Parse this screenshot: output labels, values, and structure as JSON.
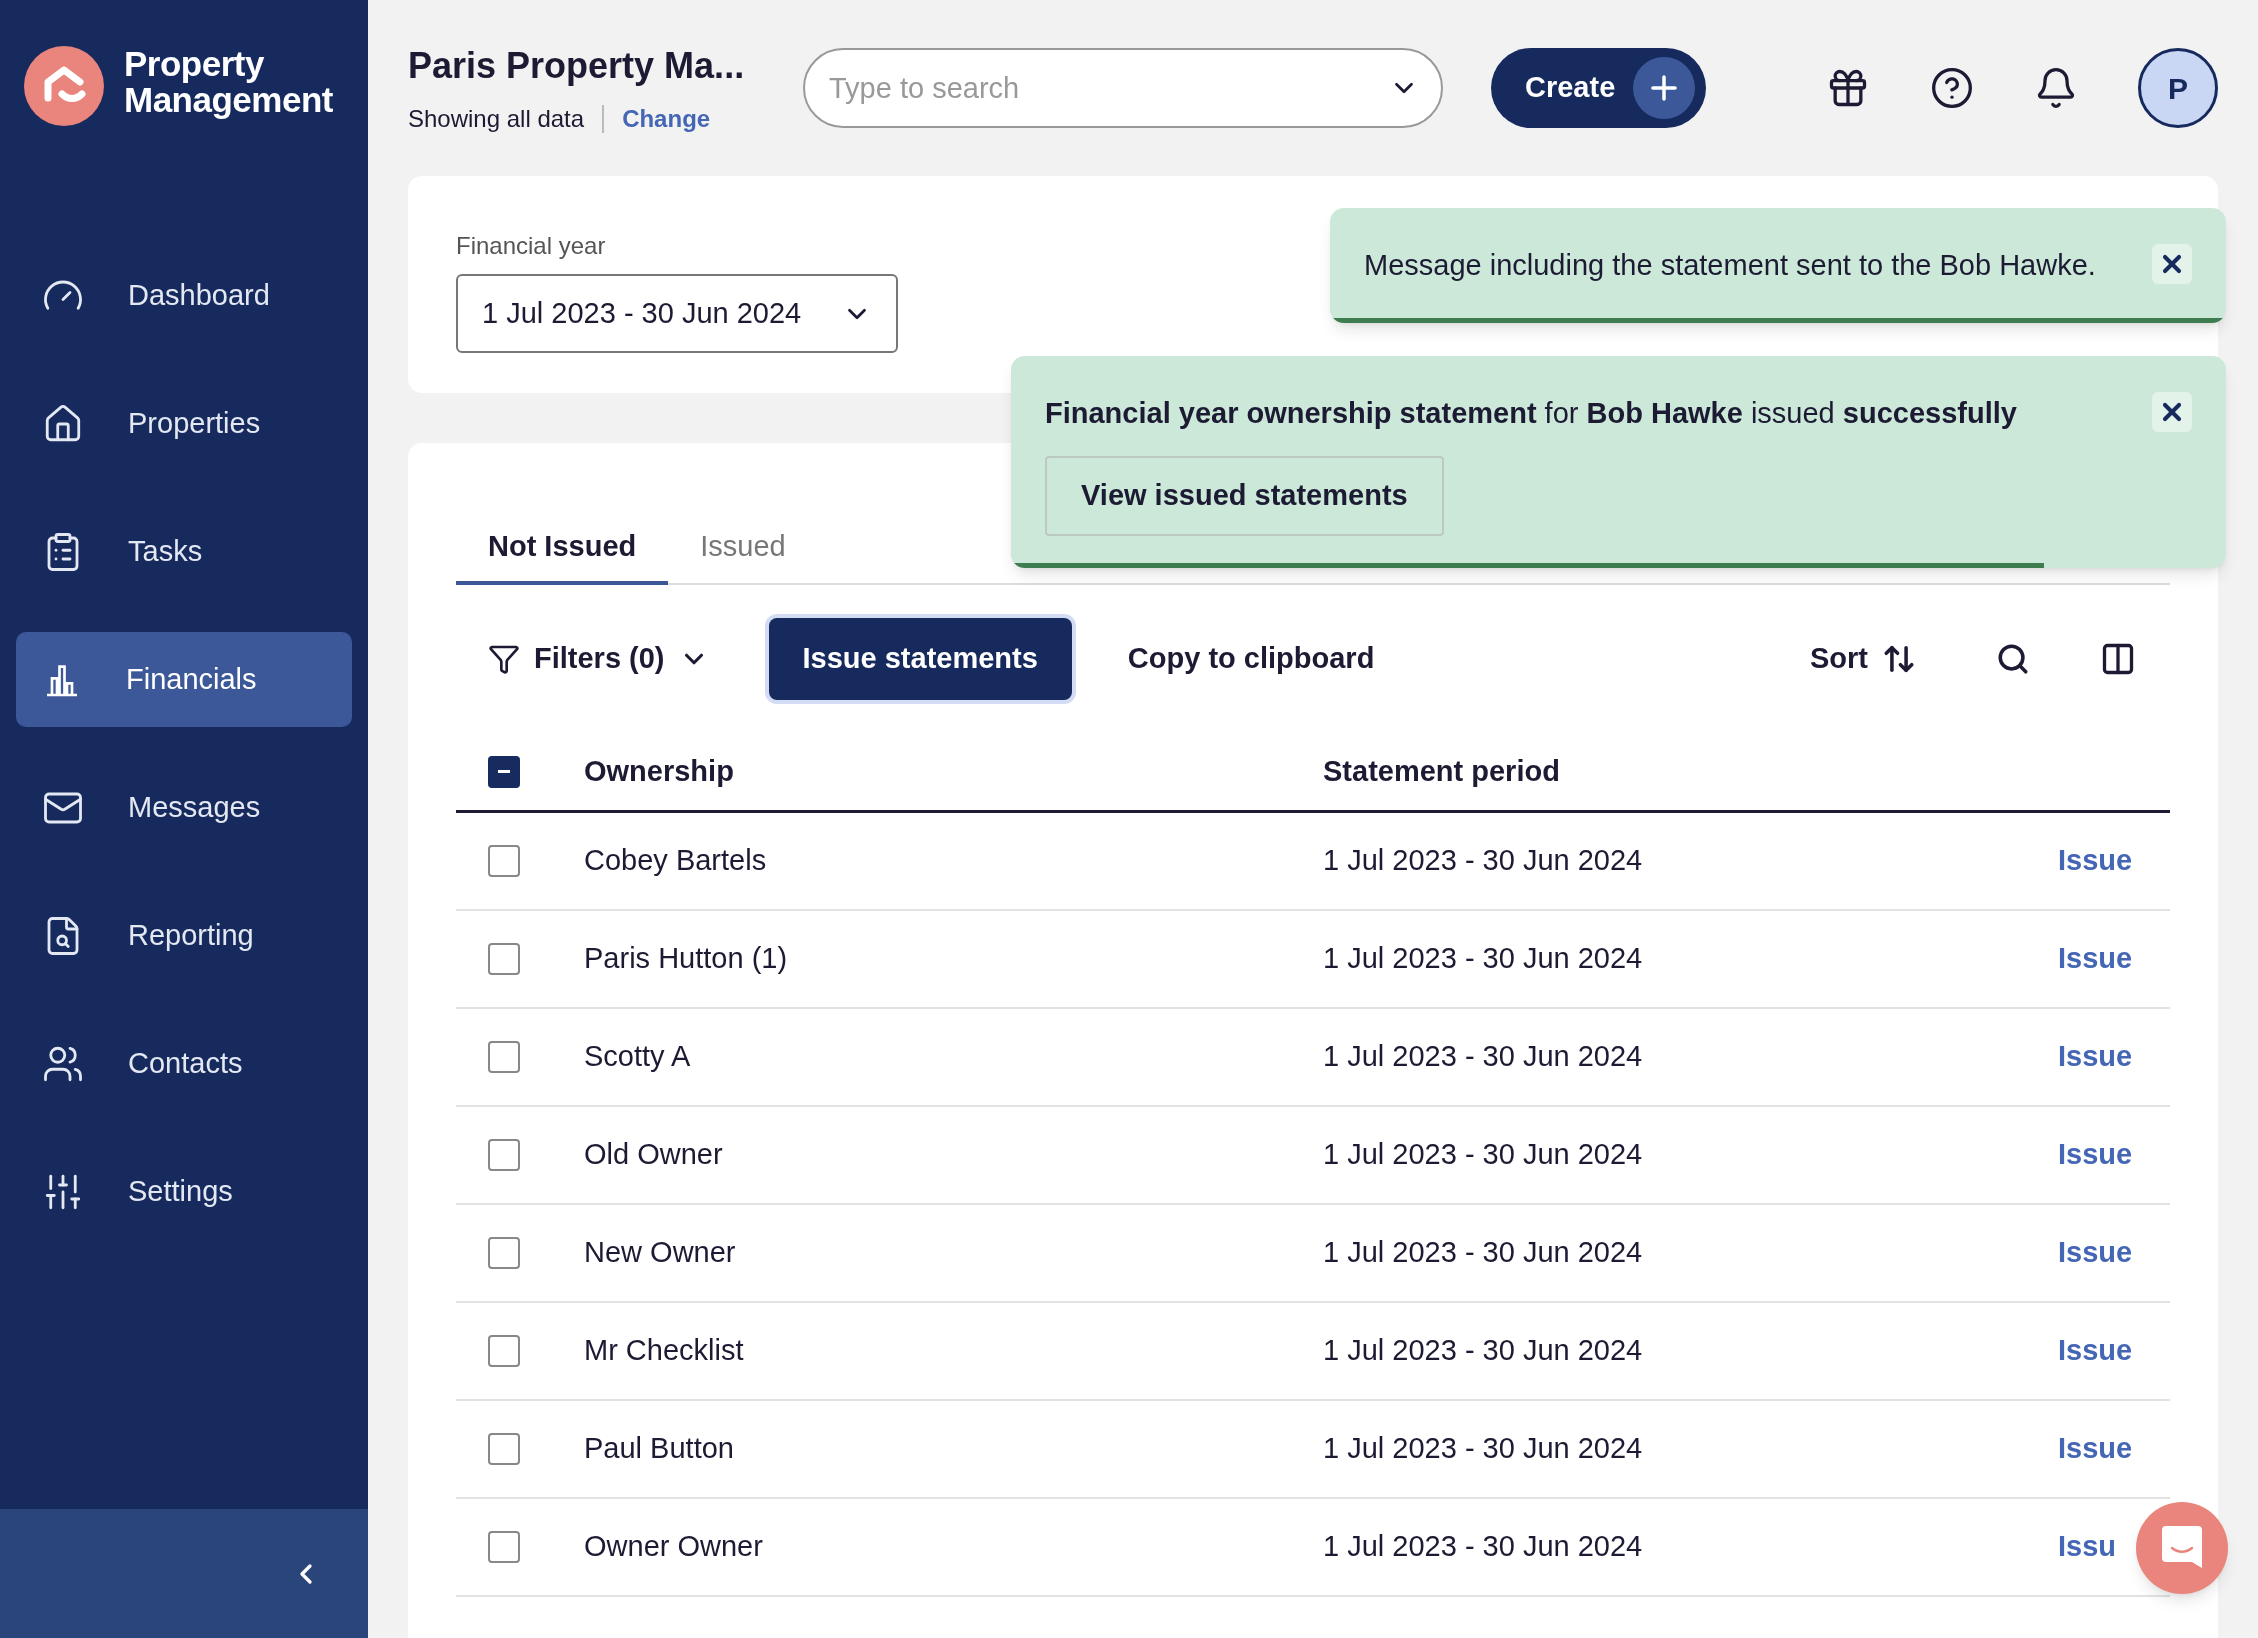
{
  "brand": {
    "name": "Property Management"
  },
  "sidebar": {
    "items": [
      {
        "label": "Dashboard",
        "selected": false
      },
      {
        "label": "Properties",
        "selected": false
      },
      {
        "label": "Tasks",
        "selected": false
      },
      {
        "label": "Financials",
        "selected": true
      },
      {
        "label": "Messages",
        "selected": false
      },
      {
        "label": "Reporting",
        "selected": false
      },
      {
        "label": "Contacts",
        "selected": false
      },
      {
        "label": "Settings",
        "selected": false
      }
    ]
  },
  "header": {
    "title": "Paris Property Ma...",
    "subtitle": "Showing all data",
    "change_link": "Change",
    "search": {
      "placeholder": "Type to search"
    },
    "create_button": "Create",
    "avatar": "P"
  },
  "financial_year": {
    "label": "Financial year",
    "value": "1 Jul 2023 - 30 Jun 2024"
  },
  "toasts": [
    {
      "text": "Message including the statement sent to the Bob Hawke.",
      "level": 1
    },
    {
      "text": "**Financial year ownership statement** for **Bob Hawke** issued **successfully**",
      "button": "View issued statements",
      "level": 0.85
    }
  ],
  "tabs": [
    {
      "label": "Not Issued",
      "selected": true
    },
    {
      "label": "Issued",
      "selected": false
    }
  ],
  "toolbar": {
    "filters": "Filters (0)",
    "issue_button": "Issue statements",
    "copy_button": "Copy to clipboard",
    "sort": "Sort"
  },
  "table": {
    "header_checkbox": {
      "indeterminate": true
    },
    "columns": [
      "Ownership",
      "Statement period"
    ],
    "rows": [
      {
        "ownership": "Cobey Bartels",
        "period": "1 Jul 2023 - 30 Jun 2024",
        "action": "Issue",
        "checked": false
      },
      {
        "ownership": "Paris Hutton (1)",
        "period": "1 Jul 2023 - 30 Jun 2024",
        "action": "Issue",
        "checked": false
      },
      {
        "ownership": "Scotty A",
        "period": "1 Jul 2023 - 30 Jun 2024",
        "action": "Issue",
        "checked": false
      },
      {
        "ownership": "Old Owner",
        "period": "1 Jul 2023 - 30 Jun 2024",
        "action": "Issue",
        "checked": false
      },
      {
        "ownership": "New Owner",
        "period": "1 Jul 2023 - 30 Jun 2024",
        "action": "Issue",
        "checked": false
      },
      {
        "ownership": "Mr Checklist",
        "period": "1 Jul 2023 - 30 Jun 2024",
        "action": "Issue",
        "checked": false
      },
      {
        "ownership": "Paul Button",
        "period": "1 Jul 2023 - 30 Jun 2024",
        "action": "Issue",
        "checked": false
      },
      {
        "ownership": "Owner Owner",
        "period": "1 Jul 2023 - 30 Jun 2024",
        "action": "Issu",
        "checked": false
      }
    ]
  }
}
